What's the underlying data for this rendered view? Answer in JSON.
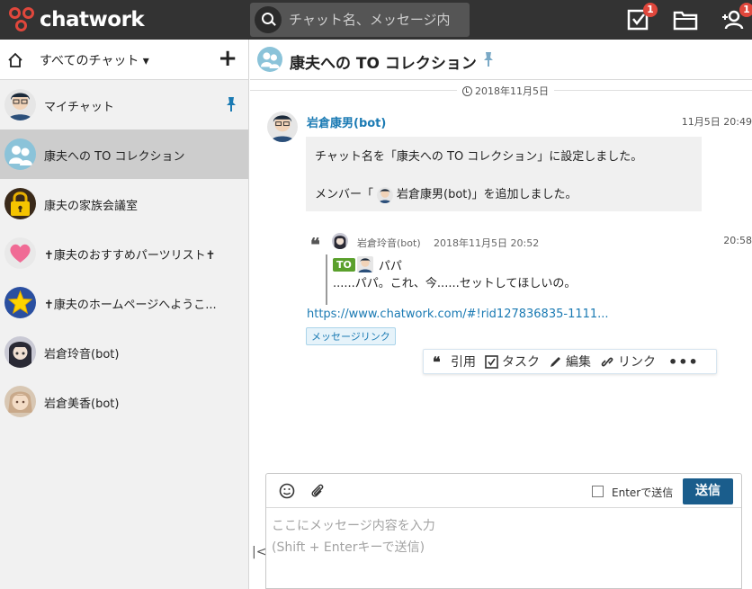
{
  "app": {
    "logo_text": "chatwork",
    "brand_color": "#e0473c"
  },
  "search": {
    "placeholder": "チャット名、メッセージ内"
  },
  "top_icons": [
    {
      "name": "task-icon",
      "badge": "1"
    },
    {
      "name": "folder-icon",
      "badge": ""
    },
    {
      "name": "add-contact-icon",
      "badge": "1"
    }
  ],
  "sidebar": {
    "filter_label": "すべてのチャット ▾",
    "add_label": "+",
    "rooms": [
      {
        "name": "マイチャット",
        "avatar": "man-avatar",
        "pinned": true,
        "active": false
      },
      {
        "name": "康夫への TO コレクション",
        "avatar": "group-avatar",
        "pinned": false,
        "active": true
      },
      {
        "name": "康夫の家族会議室",
        "avatar": "lock-avatar",
        "pinned": false,
        "active": false
      },
      {
        "name": "✝康夫のおすすめパーツリスト✝",
        "avatar": "heart-avatar",
        "pinned": false,
        "active": false
      },
      {
        "name": "✝康夫のホームページへようこ...",
        "avatar": "star-avatar",
        "pinned": false,
        "active": false
      },
      {
        "name": "岩倉玲音(bot)",
        "avatar": "girl-avatar",
        "pinned": false,
        "active": false
      },
      {
        "name": "岩倉美香(bot)",
        "avatar": "woman-avatar",
        "pinned": false,
        "active": false
      }
    ]
  },
  "chat": {
    "title": "康夫への TO コレクション",
    "date_label": "2018年11月5日",
    "message": {
      "sender": "岩倉康男(bot)",
      "time": "11月5日 20:49",
      "line1": "チャット名を「康夫への TO コレクション」に設定しました。",
      "line2_prefix": "メンバー「",
      "line2_suffix": "岩倉康男(bot)」を追加しました。"
    },
    "quote": {
      "mark": "❝",
      "author": "岩倉玲音(bot)",
      "date": "2018年11月5日 20:52",
      "time": "20:58",
      "to_badge": "TO",
      "to_name": "パパ",
      "text": "......パパ。これ、今......セットしてほしいの。"
    },
    "link": "https://www.chatwork.com/#!rid127836835-1111...",
    "link_tag": "メッセージリンク",
    "actions": {
      "quote": "引用",
      "task": "タスク",
      "edit": "編集",
      "link": "リンク",
      "more": "•••"
    }
  },
  "composer": {
    "enter_label": "Enterで送信",
    "send_label": "送信",
    "placeholder": "ここにメッセージ内容を入力\n(Shift + Enterキーで送信)",
    "collapse": "|<"
  }
}
